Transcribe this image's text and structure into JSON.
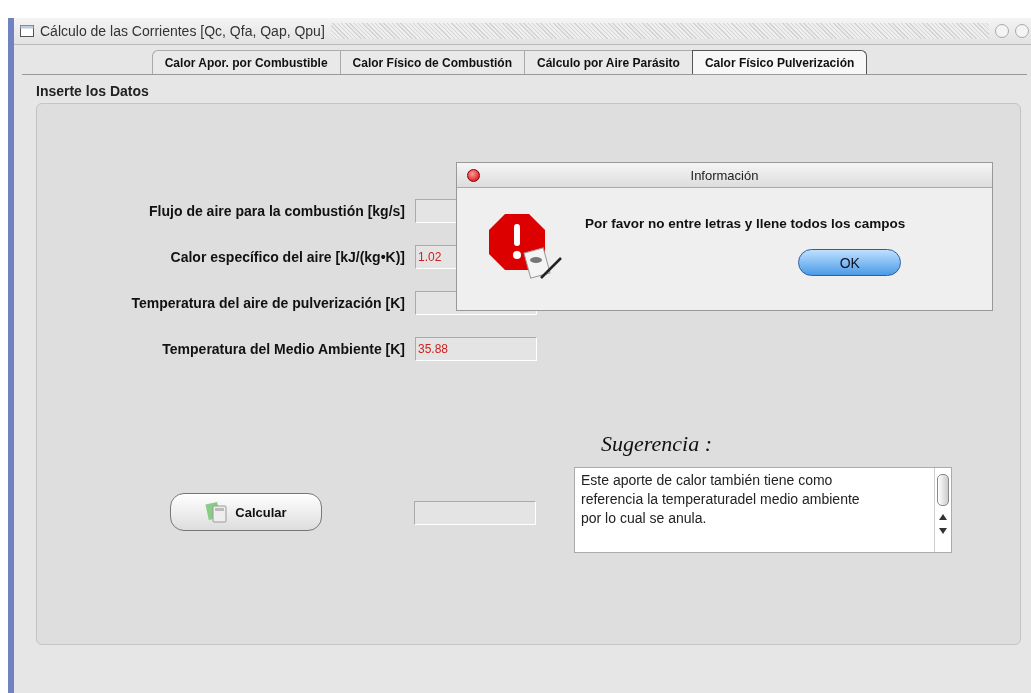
{
  "window": {
    "title": "Cálculo de las Corrientes [Qc, Qfa, Qap, Qpu]"
  },
  "tabs": [
    {
      "label": "Calor Apor. por Combustible",
      "selected": false
    },
    {
      "label": "Calor Físico de Combustión",
      "selected": false
    },
    {
      "label": "Cálculo por Aire Parásito",
      "selected": false
    },
    {
      "label": "Calor Físico Pulverización",
      "selected": true
    }
  ],
  "panel": {
    "title": "Inserte los Datos"
  },
  "fields": [
    {
      "label": "Flujo de aire para la combustión [kg/s]"
    },
    {
      "label": "Calor específico del aire [kJ/(kg•K)]",
      "value": "1.02"
    },
    {
      "label": "Temperatura del aire de pulverización [K]"
    },
    {
      "label": "Temperatura del Medio Ambiente [K]",
      "value": "35.88"
    }
  ],
  "calculate_button": {
    "label": "Calcular"
  },
  "suggestion": {
    "title": "Sugerencia :",
    "text": "Este aporte de calor también tiene como referencia la temperaturadel medio ambiente por lo cual se anula."
  },
  "dialog": {
    "title": "Información",
    "message": "Por favor no entre letras y llene todos los campos",
    "button": "OK"
  }
}
